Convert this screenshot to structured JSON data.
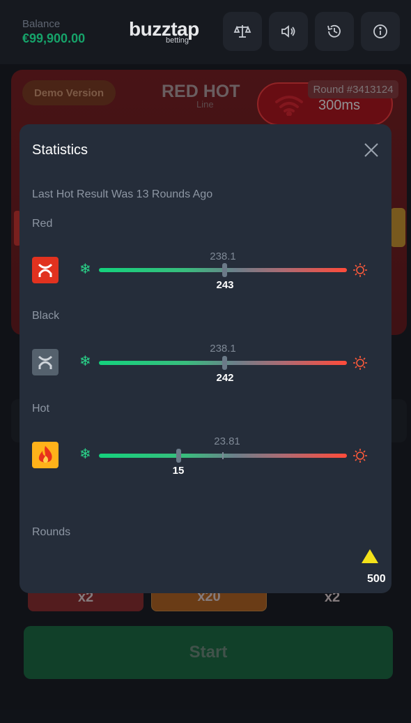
{
  "header": {
    "balance_label": "Balance",
    "balance_value": "€99,900.00",
    "logo": "buzztap",
    "logo_sub": "betting",
    "buttons": [
      {
        "icon": "scales-icon"
      },
      {
        "icon": "speaker-icon"
      },
      {
        "icon": "history-icon"
      },
      {
        "icon": "info-icon"
      }
    ]
  },
  "game": {
    "demo_badge": "Demo Version",
    "logo_title": "RED HOT",
    "logo_sub": "Line",
    "round_label": "Round #3413124",
    "ping": "300ms",
    "multipliers": [
      "x2",
      "x20",
      "x2"
    ],
    "start_label": "Start"
  },
  "stats": {
    "title": "Statistics",
    "last_hot": "Last Hot Result Was 13 Rounds Ago",
    "rows": [
      {
        "label": "Red",
        "avg": "238.1",
        "value": "243",
        "avg_pos": 0.5,
        "value_pos": 0.5
      },
      {
        "label": "Black",
        "avg": "238.1",
        "value": "242",
        "avg_pos": 0.5,
        "value_pos": 0.5
      },
      {
        "label": "Hot",
        "avg": "23.81",
        "value": "15",
        "avg_pos": 0.5,
        "value_pos": 0.32
      }
    ],
    "rounds_label": "Rounds",
    "rounds_value": "500"
  },
  "colors": {
    "accent_green": "#16a36a",
    "hot_red": "#ff4b3a",
    "cold_green": "#14d27d"
  }
}
